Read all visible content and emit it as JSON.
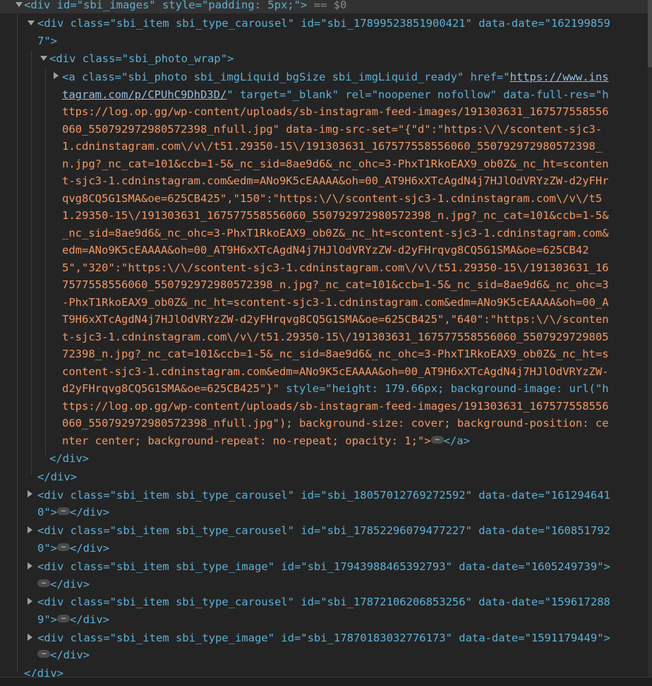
{
  "root": {
    "open": "<div id=\"sbi_images\" style=\"padding: 5px;\">",
    "eq": " == $0",
    "close": "</div>"
  },
  "item1": {
    "line1": "<div class=\"sbi_item sbi_type_carousel\" id=\"sbi_17899523851900421\" data-date=\"162199859",
    "line2": "7\">",
    "close": "</div>"
  },
  "photo_wrap": {
    "open": "<div class=\"sbi_photo_wrap\">",
    "close": "</div>"
  },
  "anchor": {
    "l1_pre": "<a class=\"sbi_photo sbi_imgLiquid_bgSize sbi_imgLiquid_ready\" href=\"",
    "l1_link": "https://www.ins",
    "l2_link": "tagram.com/p/CPUhC9DhD3D/",
    "l2_post": "\" target=\"_blank\" rel=\"noopener nofollow\" data-full-res=\"h",
    "l3": "ttps://log.op.gg/wp-content/uploads/sb-instagram-feed-images/191303631_167577558556",
    "l4": "060_550792972980572398_nfull.jpg\" data-img-src-set=\"{\"d\":\"https:\\/\\/scontent-sjc3-",
    "l5": "1.cdninstagram.com\\/v\\/t51.29350-15\\/191303631_167577558556060_550792972980572398_",
    "l6": "n.jpg?_nc_cat=101&ccb=1-5&_nc_sid=8ae9d6&_nc_ohc=3-PhxT1RkoEAX9_ob0Z&_nc_ht=sconten",
    "l7": "t-sjc3-1.cdninstagram.com&edm=ANo9K5cEAAAA&oh=00_AT9H6xXTcAgdN4j7HJlOdVRYzZW-d2yFHr",
    "l8": "qvg8CQ5G1SMA&oe=625CB425\",\"150\":\"https:\\/\\/scontent-sjc3-1.cdninstagram.com\\/v\\/t5",
    "l9": "1.29350-15\\/191303631_167577558556060_550792972980572398_n.jpg?_nc_cat=101&ccb=1-5&",
    "l10": "_nc_sid=8ae9d6&_nc_ohc=3-PhxT1RkoEAX9_ob0Z&_nc_ht=scontent-sjc3-1.cdninstagram.com&",
    "l11": "edm=ANo9K5cEAAAA&oh=00_AT9H6xXTcAgdN4j7HJlOdVRYzZW-d2yFHrqvg8CQ5G1SMA&oe=625CB42",
    "l12": "5\",\"320\":\"https:\\/\\/scontent-sjc3-1.cdninstagram.com\\/v\\/t51.29350-15\\/191303631_16",
    "l13": "7577558556060_550792972980572398_n.jpg?_nc_cat=101&ccb=1-5&_nc_sid=8ae9d6&_nc_ohc=3",
    "l14": "-PhxT1RkoEAX9_ob0Z&_nc_ht=scontent-sjc3-1.cdninstagram.com&edm=ANo9K5cEAAAA&oh=00_A",
    "l15": "T9H6xXTcAgdN4j7HJlOdVRYzZW-d2yFHrqvg8CQ5G1SMA&oe=625CB425\",\"640\":\"https:\\/\\/sconten",
    "l16": "t-sjc3-1.cdninstagram.com\\/v\\/t51.29350-15\\/191303631_167577558556060_5507929729805",
    "l17": "72398_n.jpg?_nc_cat=101&ccb=1-5&_nc_sid=8ae9d6&_nc_ohc=3-PhxT1RkoEAX9_ob0Z&_nc_ht=s",
    "l18": "content-sjc3-1.cdninstagram.com&edm=ANo9K5cEAAAA&oh=00_AT9H6xXTcAgdN4j7HJlOdVRYzZW-",
    "l19a": "d2yFHrqvg8CQ5G1SMA&oe=625CB425\"}\"",
    "l19b": " style=\"height: 179.66px; background-image: url(\"h",
    "l20": "ttps://log.op.gg/wp-content/uploads/sb-instagram-feed-images/191303631_167577558556",
    "l21": "060_550792972980572398_nfull.jpg\"); background-size: cover; background-position: ce",
    "l22": "nter center; background-repeat: no-repeat; opacity: 1;\">",
    "close": "</a>"
  },
  "items": [
    {
      "line1": "<div class=\"sbi_item sbi_type_carousel\" id=\"sbi_18057012769272592\" data-date=\"161294641",
      "line2": "0\">",
      "close": "</div>"
    },
    {
      "line1": "<div class=\"sbi_item sbi_type_carousel\" id=\"sbi_17852296079477227\" data-date=\"160851792",
      "line2": "0\">",
      "close": "</div>"
    },
    {
      "line1": "<div class=\"sbi_item sbi_type_image\" id=\"sbi_17943988465392793\" data-date=\"1605249739\">",
      "line2": "",
      "close": "</div>"
    },
    {
      "line1": "<div class=\"sbi_item sbi_type_carousel\" id=\"sbi_17872106206853256\" data-date=\"159617288",
      "line2": "9\">",
      "close": "</div>"
    },
    {
      "line1": "<div class=\"sbi_item sbi_type_image\" id=\"sbi_17870183032776173\" data-date=\"1591179449\">",
      "line2": "",
      "close": "</div>"
    }
  ],
  "colors": {
    "background": "#242424",
    "tag": "#5db0d7",
    "attr_name": "#9bbbdc",
    "attr_value": "#f29766",
    "selected_row": "#323232"
  }
}
